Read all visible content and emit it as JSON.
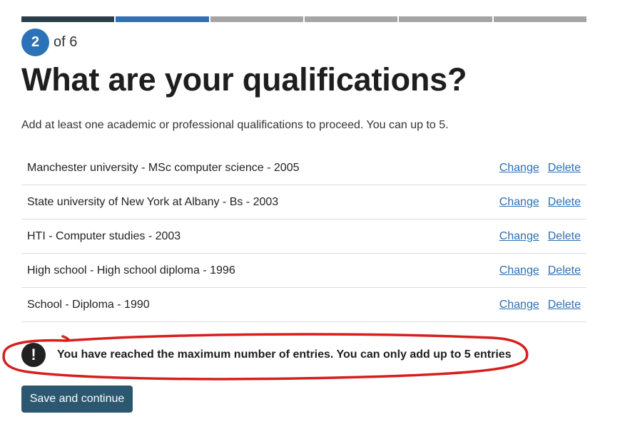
{
  "progress": {
    "total_steps": 6,
    "current_step": 2
  },
  "step": {
    "number": "2",
    "of_label": "of 6"
  },
  "page": {
    "title": "What are your qualifications?",
    "intro": "Add at least one academic or professional qualifications to proceed. You can up to 5."
  },
  "qualifications": [
    {
      "text": "Manchester university - MSc computer science - 2005",
      "change": "Change",
      "delete": "Delete"
    },
    {
      "text": "State university of New York at Albany - Bs - 2003",
      "change": "Change",
      "delete": "Delete"
    },
    {
      "text": "HTI - Computer studies - 2003",
      "change": "Change",
      "delete": "Delete"
    },
    {
      "text": "High school - High school diploma - 1996",
      "change": "Change",
      "delete": "Delete"
    },
    {
      "text": "School - Diploma - 1990",
      "change": "Change",
      "delete": "Delete"
    }
  ],
  "alert": {
    "icon": "exclamation-icon",
    "icon_glyph": "!",
    "message": "You have reached the maximum number of entries. You can only add up to 5 entries"
  },
  "actions": {
    "save_label": "Save and continue"
  },
  "colors": {
    "accent": "#2c72b8",
    "progress_done": "#2b3f4a",
    "progress_todo": "#a5a5a5",
    "link": "#2c6fb2",
    "button": "#2b5870",
    "annotation": "#d81e1e"
  }
}
